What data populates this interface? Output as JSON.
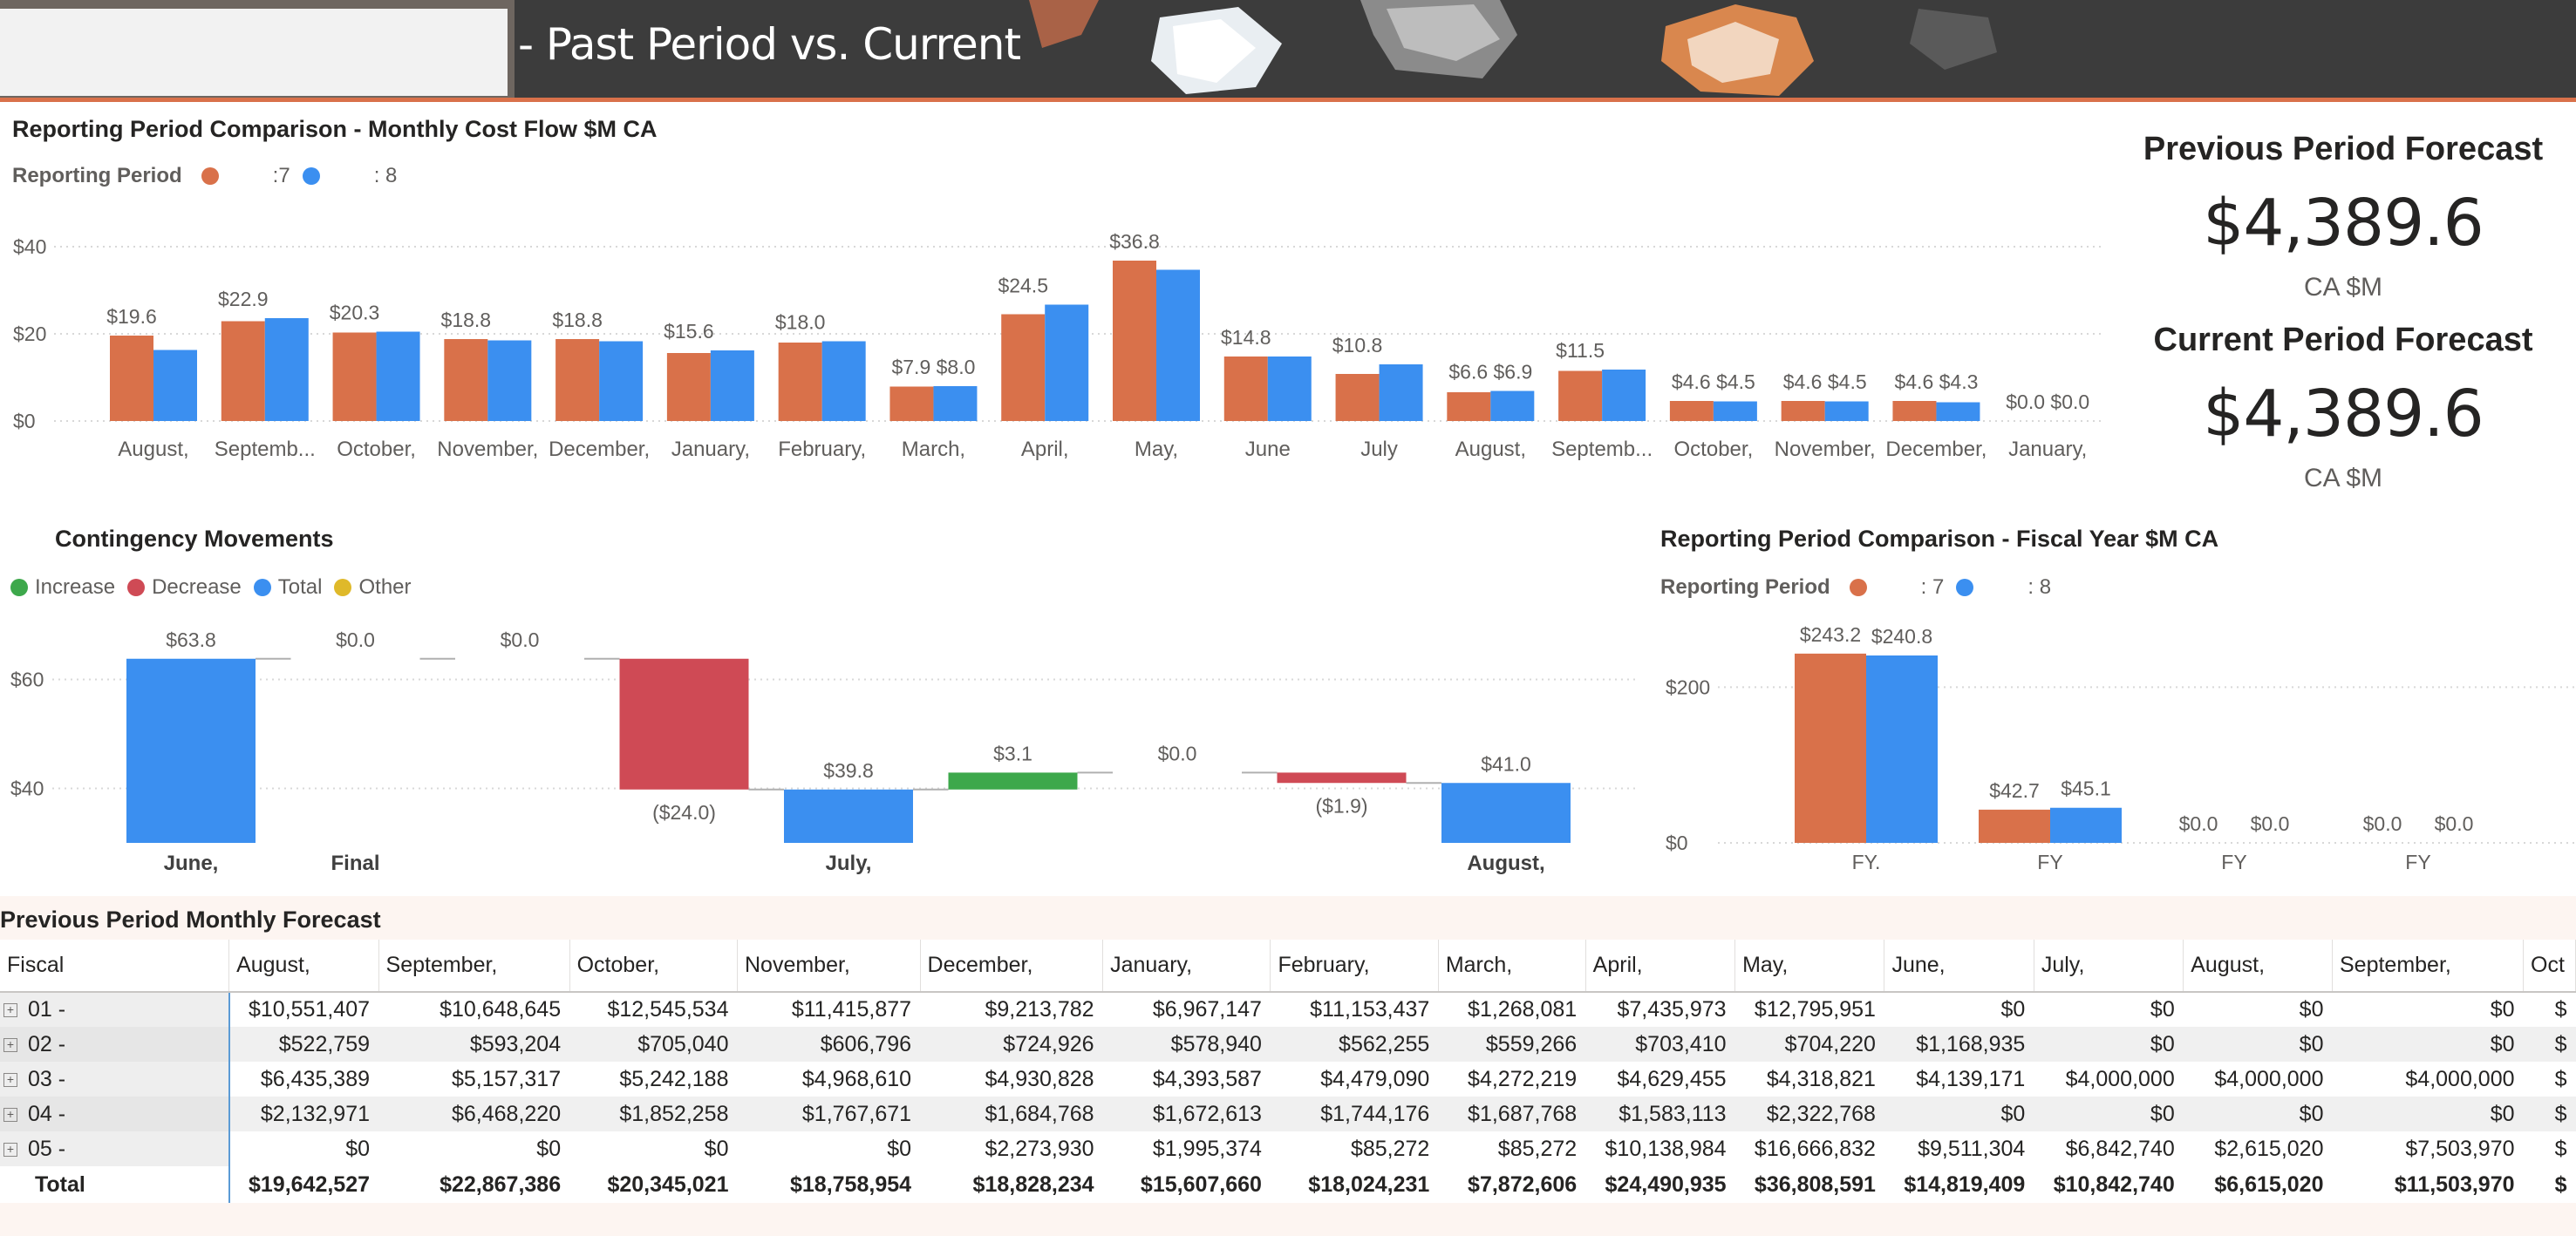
{
  "banner": {
    "title": "- Past Period vs. Current"
  },
  "monthly_chart": {
    "title": "Reporting Period Comparison - Monthly Cost Flow $M CA",
    "legend_title": "Reporting Period",
    "legend_items": [
      ":7",
      ": 8"
    ]
  },
  "kpis": {
    "previous": {
      "title": "Previous Period Forecast",
      "value": "$4,389.6",
      "unit": "CA $M"
    },
    "current": {
      "title": "Current Period Forecast",
      "value": "$4,389.6",
      "unit": "CA $M"
    }
  },
  "waterfall_chart": {
    "title": "Contingency Movements",
    "legend_items": [
      "Increase",
      "Decrease",
      "Total",
      "Other"
    ]
  },
  "fiscal_chart": {
    "title": "Reporting Period Comparison - Fiscal Year $M CA",
    "legend_title": "Reporting Period",
    "legend_items": [
      ": 7",
      ": 8"
    ]
  },
  "table": {
    "title": "Previous Period Monthly Forecast",
    "headers": [
      "Fiscal",
      "August,",
      "September,",
      "October,",
      "November,",
      "December,",
      "January,",
      "February,",
      "March,",
      "April,",
      "May,",
      "June,",
      "July,",
      "August,",
      "September,",
      "Oct"
    ],
    "rows": [
      {
        "label": "01 -",
        "values": [
          "$10,551,407",
          "$10,648,645",
          "$12,545,534",
          "$11,415,877",
          "$9,213,782",
          "$6,967,147",
          "$11,153,437",
          "$1,268,081",
          "$7,435,973",
          "$12,795,951",
          "$0",
          "$0",
          "$0",
          "$0",
          "$"
        ]
      },
      {
        "label": "02 -",
        "values": [
          "$522,759",
          "$593,204",
          "$705,040",
          "$606,796",
          "$724,926",
          "$578,940",
          "$562,255",
          "$559,266",
          "$703,410",
          "$704,220",
          "$1,168,935",
          "$0",
          "$0",
          "$0",
          "$"
        ]
      },
      {
        "label": "03 -",
        "values": [
          "$6,435,389",
          "$5,157,317",
          "$5,242,188",
          "$4,968,610",
          "$4,930,828",
          "$4,393,587",
          "$4,479,090",
          "$4,272,219",
          "$4,629,455",
          "$4,318,821",
          "$4,139,171",
          "$4,000,000",
          "$4,000,000",
          "$4,000,000",
          "$"
        ]
      },
      {
        "label": "04 -",
        "values": [
          "$2,132,971",
          "$6,468,220",
          "$1,852,258",
          "$1,767,671",
          "$1,684,768",
          "$1,672,613",
          "$1,744,176",
          "$1,687,768",
          "$1,583,113",
          "$2,322,768",
          "$0",
          "$0",
          "$0",
          "$0",
          "$"
        ]
      },
      {
        "label": "05 -",
        "values": [
          "$0",
          "$0",
          "$0",
          "$0",
          "$2,273,930",
          "$1,995,374",
          "$85,272",
          "$85,272",
          "$10,138,984",
          "$16,666,832",
          "$9,511,304",
          "$6,842,740",
          "$2,615,020",
          "$7,503,970",
          "$"
        ]
      }
    ],
    "total": {
      "label": "Total",
      "values": [
        "$19,642,527",
        "$22,867,386",
        "$20,345,021",
        "$18,758,954",
        "$18,828,234",
        "$15,607,660",
        "$18,024,231",
        "$7,872,606",
        "$24,490,935",
        "$36,808,591",
        "$14,819,409",
        "$10,842,740",
        "$6,615,020",
        "$11,503,970",
        "$"
      ]
    }
  },
  "chart_data": [
    {
      "type": "bar",
      "title": "Reporting Period Comparison - Monthly Cost Flow $M CA",
      "categories": [
        "August,",
        "Septemb...",
        "October,",
        "November,",
        "December,",
        "January,",
        "February,",
        "March,",
        "April,",
        "May,",
        "June",
        "July",
        "August,",
        "Septemb...",
        "October,",
        "November,",
        "December,",
        "January,"
      ],
      "series": [
        {
          "name": ":7",
          "values": [
            19.6,
            22.9,
            20.3,
            18.8,
            18.8,
            15.6,
            18.0,
            7.9,
            24.5,
            36.8,
            14.8,
            10.8,
            6.6,
            11.5,
            4.6,
            4.6,
            4.6,
            0.0
          ]
        },
        {
          "name": ": 8",
          "values": [
            16.3,
            23.6,
            20.5,
            18.5,
            18.3,
            16.2,
            18.3,
            8.0,
            26.7,
            34.7,
            14.8,
            13.0,
            6.9,
            11.8,
            4.5,
            4.5,
            4.3,
            0.0
          ]
        }
      ],
      "value_labels": [
        "$19.6",
        "$22.9",
        "$20.3",
        "$18.8",
        "$18.8",
        "$15.6",
        "$18.0",
        "$7.9 $8.0",
        "$24.5",
        "$36.8",
        "$14.8",
        "$10.8",
        "$6.6 $6.9",
        "$11.5",
        "$4.6 $4.5",
        "$4.6 $4.5",
        "$4.6 $4.3",
        "$0.0 $0.0"
      ],
      "ytick_labels": [
        "$0",
        "$20",
        "$40"
      ],
      "colors": [
        "#d9714a",
        "#3b8ff0"
      ],
      "ylim": [
        0,
        42
      ],
      "legend": "top-left",
      "grid": true
    },
    {
      "type": "waterfall",
      "title": "Contingency Movements",
      "steps": [
        {
          "kind": "Total",
          "start": 30,
          "end": 63.8,
          "label": "$63.8"
        },
        {
          "kind": "Increase",
          "start": 63.8,
          "end": 63.8,
          "label": "$0.0"
        },
        {
          "kind": "Increase",
          "start": 63.8,
          "end": 63.8,
          "label": "$0.0"
        },
        {
          "kind": "Decrease",
          "start": 63.8,
          "end": 39.8,
          "label": "($24.0)"
        },
        {
          "kind": "Total",
          "start": 30,
          "end": 39.8,
          "label": "$39.8"
        },
        {
          "kind": "Increase",
          "start": 39.8,
          "end": 42.9,
          "label": "$3.1"
        },
        {
          "kind": "Increase",
          "start": 42.9,
          "end": 42.9,
          "label": "$0.0"
        },
        {
          "kind": "Decrease",
          "start": 42.9,
          "end": 41.0,
          "label": "($1.9)"
        },
        {
          "kind": "Total",
          "start": 30,
          "end": 41.0,
          "label": "$41.0"
        }
      ],
      "group_labels": [
        "June,",
        "Final",
        "July,",
        "August,"
      ],
      "ytick_labels": [
        "$40",
        "$60"
      ],
      "colors": {
        "Increase": "#3da84b",
        "Decrease": "#cf4a55",
        "Total": "#3b8ff0",
        "Other": "#dfb92a"
      },
      "ylim": [
        30,
        70
      ],
      "legend": "top-left",
      "grid": true
    },
    {
      "type": "bar",
      "title": "Reporting Period Comparison - Fiscal Year $M CA",
      "categories": [
        "FY.",
        "FY",
        "FY",
        "FY"
      ],
      "series": [
        {
          "name": ": 7",
          "values": [
            243.2,
            42.7,
            0.0,
            0.0
          ]
        },
        {
          "name": ": 8",
          "values": [
            240.8,
            45.1,
            0.0,
            0.0
          ]
        }
      ],
      "value_labels": [
        [
          "$243.2",
          "$42.7",
          "$0.0",
          "$0.0"
        ],
        [
          "$240.8",
          "$45.1",
          "$0.0",
          "$0.0"
        ]
      ],
      "ytick_labels": [
        "$0",
        "$200"
      ],
      "colors": [
        "#d9714a",
        "#3b8ff0"
      ],
      "ylim": [
        0,
        280
      ],
      "legend": "top-left",
      "grid": true
    }
  ]
}
